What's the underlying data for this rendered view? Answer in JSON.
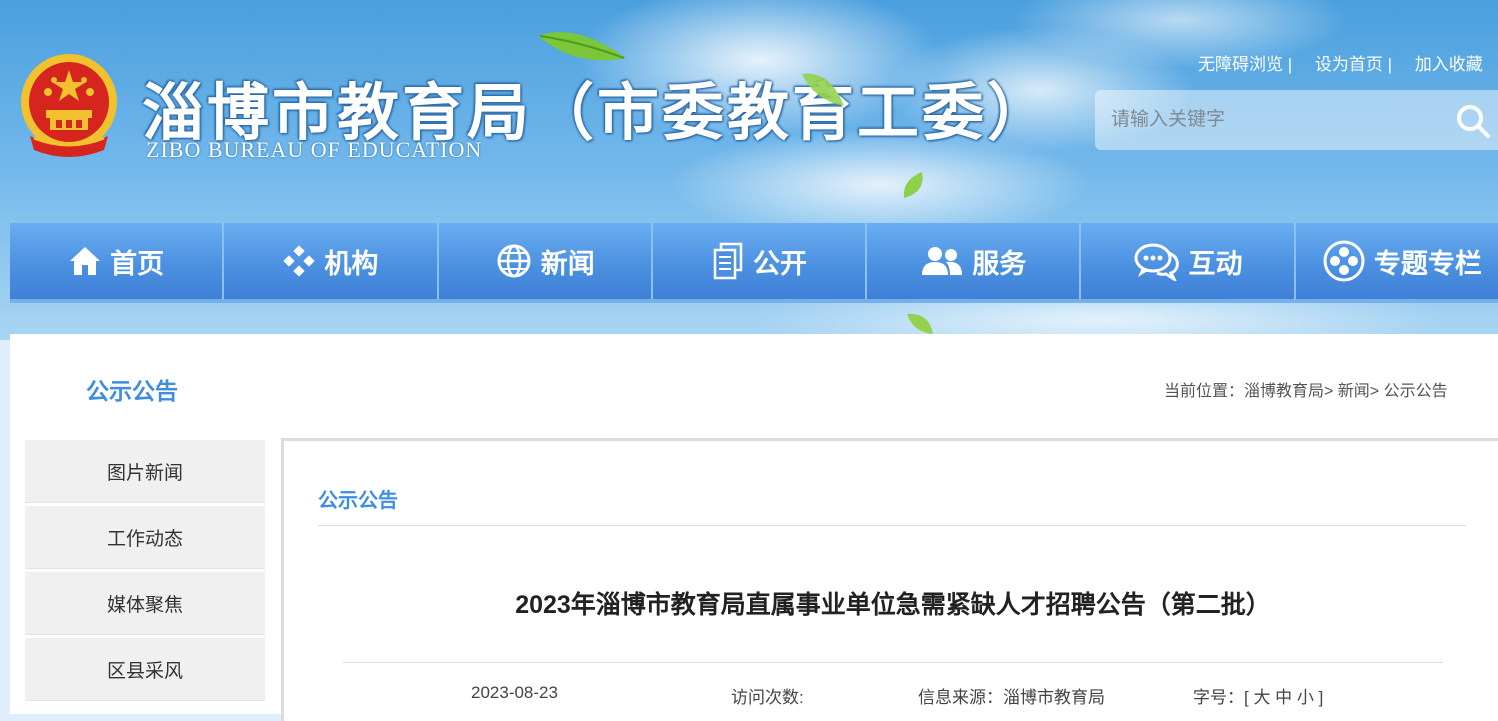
{
  "header": {
    "title": "淄博市教育局（市委教育工委）",
    "subtitle": "ZIBO BUREAU OF EDUCATION",
    "top_links": [
      "无障碍浏览 |",
      "设为首页 |",
      "加入收藏"
    ],
    "search_placeholder": "请输入关键字"
  },
  "nav": [
    {
      "label": "首页",
      "icon": "home-icon"
    },
    {
      "label": "机构",
      "icon": "org-icon"
    },
    {
      "label": "新闻",
      "icon": "globe-icon"
    },
    {
      "label": "公开",
      "icon": "document-icon"
    },
    {
      "label": "服务",
      "icon": "users-icon"
    },
    {
      "label": "互动",
      "icon": "chat-icon"
    },
    {
      "label": "专题专栏",
      "icon": "special-icon"
    }
  ],
  "section": {
    "title": "公示公告",
    "breadcrumb": "当前位置：淄博教育局> 新闻> 公示公告"
  },
  "sidebar": {
    "items": [
      "图片新闻",
      "工作动态",
      "媒体聚焦",
      "区县采风"
    ]
  },
  "article": {
    "category": "公示公告",
    "title": "2023年淄博市教育局直属事业单位急需紧缺人才招聘公告（第二批）",
    "date": "2023-08-23",
    "visits_label": "访问次数:",
    "source": "信息来源：淄博市教育局",
    "font_size_label": "字号：[ 大 中 小 ]"
  },
  "colors": {
    "nav_blue": "#4a8fe0",
    "accent_blue": "#3d8ee3",
    "emblem_red": "#d6241e",
    "emblem_gold": "#f2c12e"
  }
}
